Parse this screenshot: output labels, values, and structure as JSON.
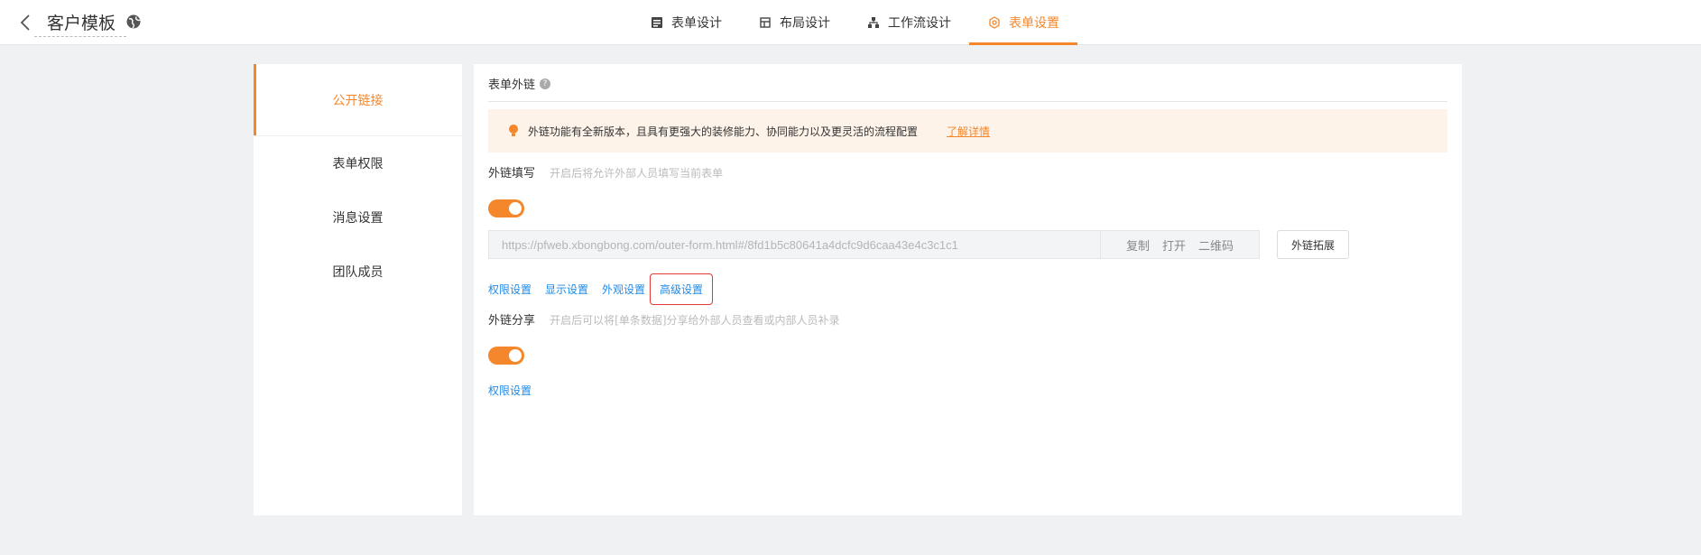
{
  "header": {
    "title": "客户模板",
    "back_icon": "chevron-left-icon",
    "globe_icon": "globe-icon",
    "tabs": [
      {
        "label": "表单设计",
        "icon": "form-icon"
      },
      {
        "label": "布局设计",
        "icon": "layout-icon"
      },
      {
        "label": "工作流设计",
        "icon": "workflow-icon"
      },
      {
        "label": "表单设置",
        "icon": "gear-icon",
        "active": true
      }
    ]
  },
  "sidebar": {
    "items": [
      {
        "label": "公开链接",
        "active": true
      },
      {
        "label": "表单权限"
      },
      {
        "label": "消息设置"
      },
      {
        "label": "团队成员"
      }
    ]
  },
  "main": {
    "section_title": "表单外链",
    "notice": {
      "text": "外链功能有全新版本，且具有更强大的装修能力、协同能力以及更灵活的流程配置",
      "link": "了解详情"
    },
    "fill": {
      "label": "外链填写",
      "hint": "开启后将允许外部人员填写当前表单",
      "enabled": true,
      "url": "https://pfweb.xbongbong.com/outer-form.html#/8fd1b5c80641a4dcfc9d6caa43e4c3c1c1",
      "actions": [
        "复制",
        "打开",
        "二维码"
      ],
      "extend_button": "外链拓展",
      "links": [
        "权限设置",
        "显示设置",
        "外观设置",
        "高级设置"
      ]
    },
    "share": {
      "label": "外链分享",
      "hint": "开启后可以将[单条数据]分享给外部人员查看或内部人员补录",
      "enabled": true,
      "link": "权限设置"
    }
  },
  "colors": {
    "accent": "#f4872b",
    "link": "#1f8ae6",
    "highlight_border": "#e53935"
  }
}
